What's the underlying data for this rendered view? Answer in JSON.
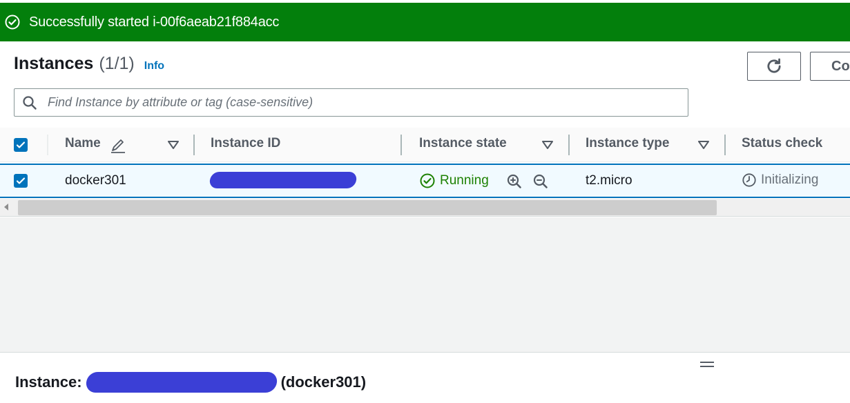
{
  "flash": {
    "message": "Successfully started i-00f6aeab21f884acc",
    "color": "#037f0c",
    "icon": "success-circle-check-icon"
  },
  "header": {
    "title": "Instances",
    "count": "(1/1)",
    "info_link": "Info",
    "refresh_icon": "refresh-icon",
    "connect_label": "Co"
  },
  "search": {
    "placeholder": "Find Instance by attribute or tag (case-sensitive)",
    "icon": "search-icon"
  },
  "table": {
    "columns": [
      "Name",
      "Instance ID",
      "Instance state",
      "Instance type",
      "Status check"
    ],
    "rows": [
      {
        "selected": true,
        "name": "docker301",
        "instance_id": "",
        "state": "Running",
        "type": "t2.micro",
        "status_check": "Initializing"
      }
    ]
  },
  "detail": {
    "prefix": "Instance:",
    "suffix": "(docker301)"
  },
  "colors": {
    "accent": "#0073bb",
    "running": "#1d8102",
    "redaction": "#3b3fd6"
  }
}
